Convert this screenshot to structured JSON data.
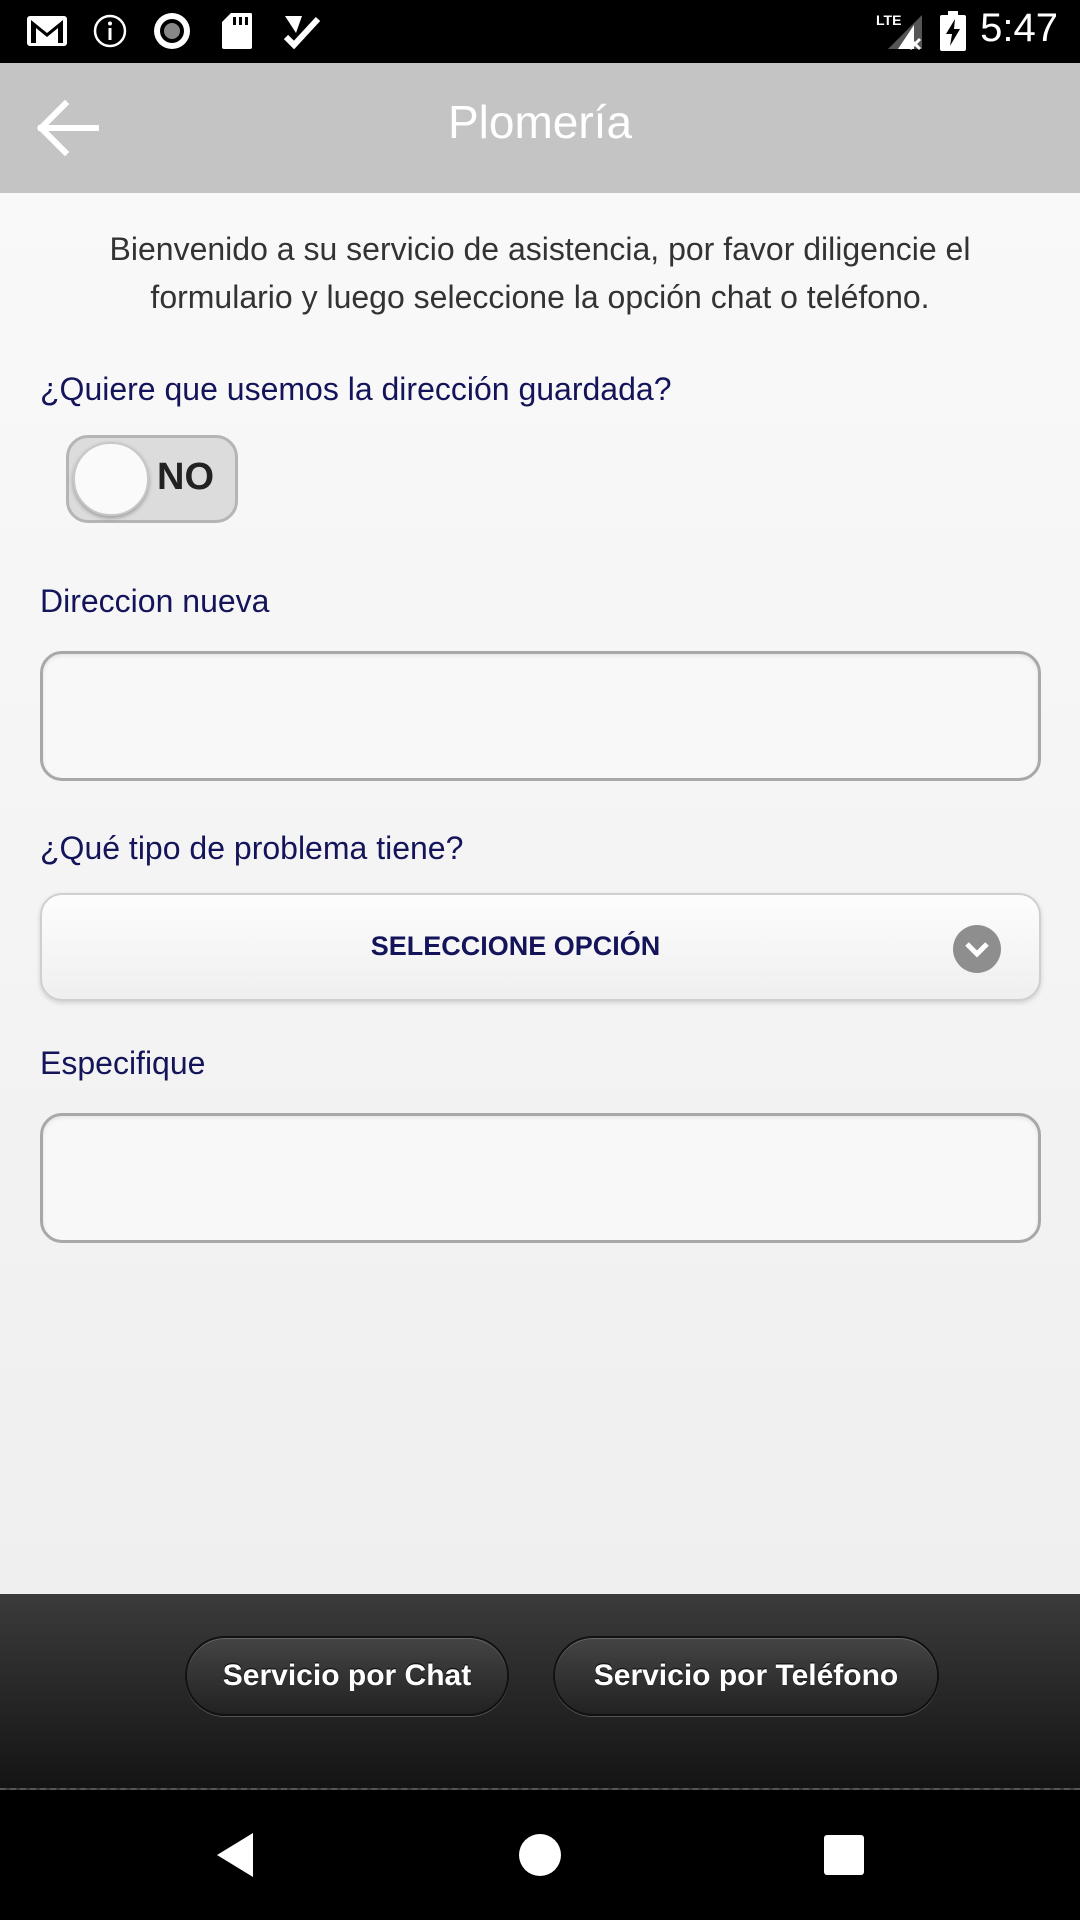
{
  "status_bar": {
    "time": "5:47",
    "network_label": "LTE",
    "icons": [
      "gmail-icon",
      "info-icon",
      "record-icon",
      "sd-card-icon",
      "checklist-icon",
      "signal-lte-icon",
      "battery-charging-icon"
    ]
  },
  "header": {
    "title": "Plomería",
    "back_icon": "arrow-left-icon"
  },
  "form": {
    "intro": "Bienvenido a su servicio de asistencia, por favor diligencie el formulario y luego seleccione la opción chat o teléfono.",
    "saved_address_question": "¿Quiere que usemos la dirección guardada?",
    "saved_address_toggle": "NO",
    "new_address_label": "Direccion nueva",
    "new_address_value": "",
    "problem_type_label": "¿Qué tipo de problema tiene?",
    "problem_type_selected": "SELECCIONE OPCIÓN",
    "specify_label": "Especifique",
    "specify_value": ""
  },
  "actions": {
    "chat_button": "Servicio por Chat",
    "phone_button": "Servicio por Teléfono"
  },
  "nav": {
    "back": "back-icon",
    "home": "home-icon",
    "recents": "recents-icon"
  },
  "colors": {
    "header_bg": "#c4c4c4",
    "label_color": "#14145a",
    "bottom_bar": "#2a2a2a"
  }
}
